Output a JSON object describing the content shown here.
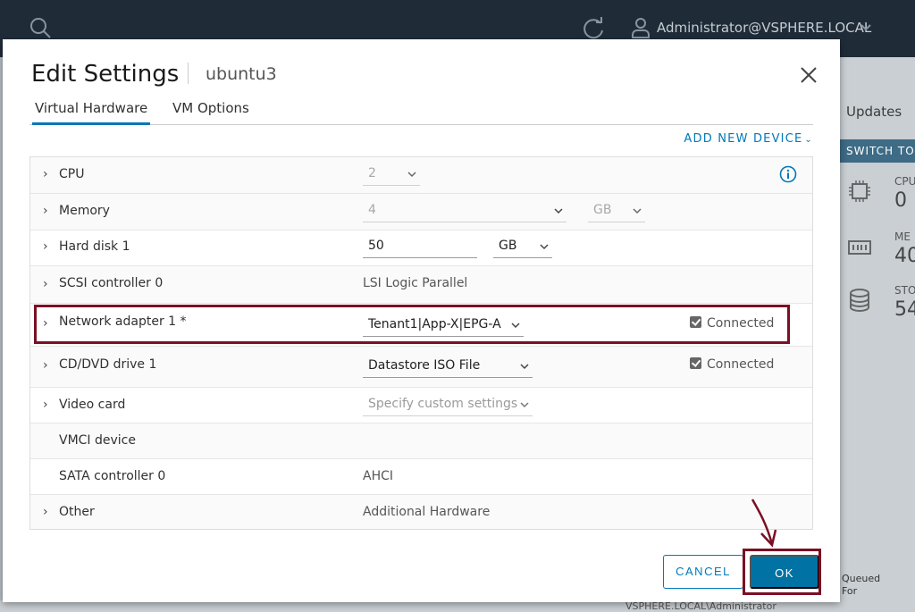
{
  "background": {
    "user": "Administrator@VSPHERE.LOCAL",
    "tab_updates": "Updates",
    "switch_button": "SWITCH TO",
    "resources": [
      {
        "icon": "cpu-icon",
        "label": "CPU",
        "value": "0"
      },
      {
        "icon": "memory-icon",
        "label": "ME",
        "value": "40"
      },
      {
        "icon": "storage-icon",
        "label": "STO",
        "value": "54"
      }
    ],
    "queued_label": "Queued For",
    "footer_text": "VSPHERE.LOCAL\\Administrator"
  },
  "dialog": {
    "title": "Edit Settings",
    "subtitle": "ubuntu3",
    "tabs": [
      {
        "label": "Virtual Hardware",
        "active": true
      },
      {
        "label": "VM Options",
        "active": false
      }
    ],
    "add_device": "ADD NEW DEVICE",
    "rows": {
      "cpu": {
        "label": "CPU",
        "value": "2"
      },
      "memory": {
        "label": "Memory",
        "value": "4",
        "unit": "GB"
      },
      "hard_disk": {
        "label": "Hard disk 1",
        "value": "50",
        "unit": "GB"
      },
      "scsi": {
        "label": "SCSI controller 0",
        "value": "LSI Logic Parallel"
      },
      "network": {
        "label": "Network adapter 1 *",
        "value": "Tenant1|App-X|EPG-A",
        "connected": "Connected"
      },
      "cdrom": {
        "label": "CD/DVD drive 1",
        "value": "Datastore ISO File",
        "connected": "Connected"
      },
      "video": {
        "label": "Video card",
        "value": "Specify custom settings"
      },
      "vmci": {
        "label": "VMCI device"
      },
      "sata": {
        "label": "SATA controller 0",
        "value": "AHCI"
      },
      "other": {
        "label": "Other",
        "value": "Additional Hardware"
      }
    },
    "buttons": {
      "cancel": "CANCEL",
      "ok": "OK"
    }
  },
  "colors": {
    "accent": "#0079b8",
    "highlight": "#7a0f24",
    "topbar": "#1f2c38"
  }
}
